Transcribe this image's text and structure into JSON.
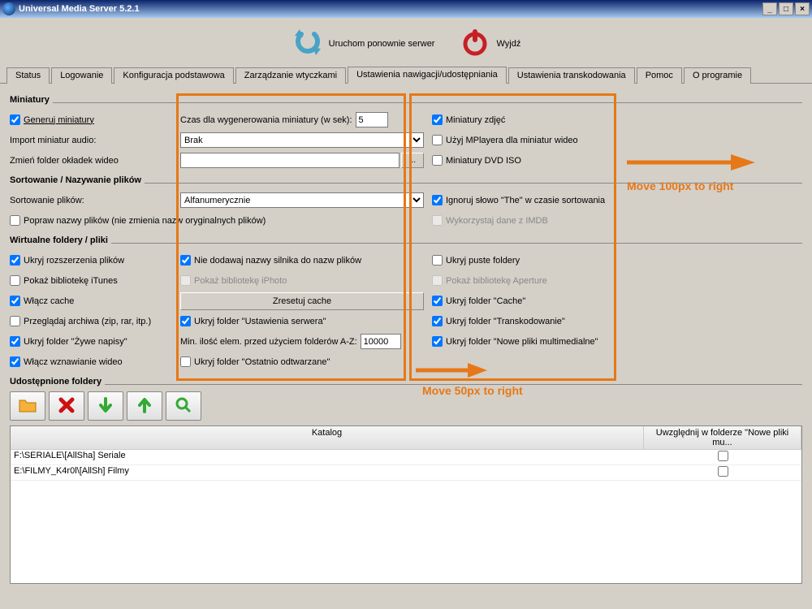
{
  "window": {
    "title": "Universal Media Server 5.2.1"
  },
  "toolbar": {
    "restart_label": "Uruchom ponownie serwer",
    "exit_label": "Wyjdź"
  },
  "tabs": [
    "Status",
    "Logowanie",
    "Konfiguracja podstawowa",
    "Zarządzanie wtyczkami",
    "Ustawienia nawigacji/udostępniania",
    "Ustawienia transkodowania",
    "Pomoc",
    "O programie"
  ],
  "active_tab_index": 4,
  "section": {
    "miniatury": {
      "title": "Miniatury",
      "generate_thumbs": "Generuj miniatury",
      "time_label": "Czas dla wygenerowania miniatury (w sek):",
      "time_value": "5",
      "photo_thumbs": "Miniatury zdjęć",
      "import_audio_label": "Import miniatur audio:",
      "import_audio_value": "Brak",
      "mplayer": "Użyj MPlayera dla miniatur wideo",
      "cover_folder_label": "Zmień folder okładek wideo",
      "cover_folder_value": "",
      "browse": "...",
      "dvd_iso": "Miniatury DVD ISO"
    },
    "sorting": {
      "title": "Sortowanie / Nazywanie plików",
      "sort_label": "Sortowanie plików:",
      "sort_value": "Alfanumerycznie",
      "ignore_the": "Ignoruj słowo \"The\" w czasie sortowania",
      "fix_names": "Popraw nazwy plików (nie zmienia nazw oryginalnych plików)",
      "imdb": "Wykorzystaj dane z IMDB"
    },
    "virtual": {
      "title": "Wirtualne foldery / pliki",
      "hide_ext": "Ukryj rozszerzenia plików",
      "no_engine_name": "Nie dodawaj nazwy silnika do nazw plików",
      "hide_empty": "Ukryj puste foldery",
      "show_itunes": "Pokaż bibliotekę iTunes",
      "show_iphoto": "Pokaż bibliotekę iPhoto",
      "show_aperture": "Pokaż bibliotekę Aperture",
      "enable_cache": "Włącz cache",
      "reset_cache": "Zresetuj cache",
      "hide_cache_folder": "Ukryj folder \"Cache\"",
      "browse_archives": "Przeglądaj archiwa (zip, rar, itp.)",
      "hide_settings_folder": "Ukryj folder \"Ustawienia serwera\"",
      "hide_transcoding_folder": "Ukryj folder \"Transkodowanie\"",
      "hide_live_subs": "Ukryj folder \"Żywe napisy\"",
      "min_elem_label": "Min. ilość elem. przed użyciem folderów A-Z:",
      "min_elem_value": "10000",
      "hide_new_media": "Ukryj folder \"Nowe pliki multimedialne\"",
      "enable_resume": "Włącz wznawianie wideo",
      "hide_last_played": "Ukryj folder \"Ostatnio odtwarzane\""
    },
    "shared": {
      "title": "Udostępnione foldery",
      "columns": {
        "path": "Katalog",
        "monitor": "Uwzględnij w folderze \"Nowe pliki mu..."
      },
      "rows": [
        {
          "path": "F:\\SERIALE\\[AllSha] Seriale",
          "monitor": false
        },
        {
          "path": "E:\\FILMY_K4r0l\\[AllSh] Filmy",
          "monitor": false
        }
      ]
    }
  },
  "annotations": {
    "move100": "Move 100px to right",
    "move50": "Move 50px to right"
  },
  "icons": {
    "folder": "folder-icon",
    "delete": "delete-icon",
    "down": "arrow-down-icon",
    "up": "arrow-up-icon",
    "search": "search-icon"
  }
}
